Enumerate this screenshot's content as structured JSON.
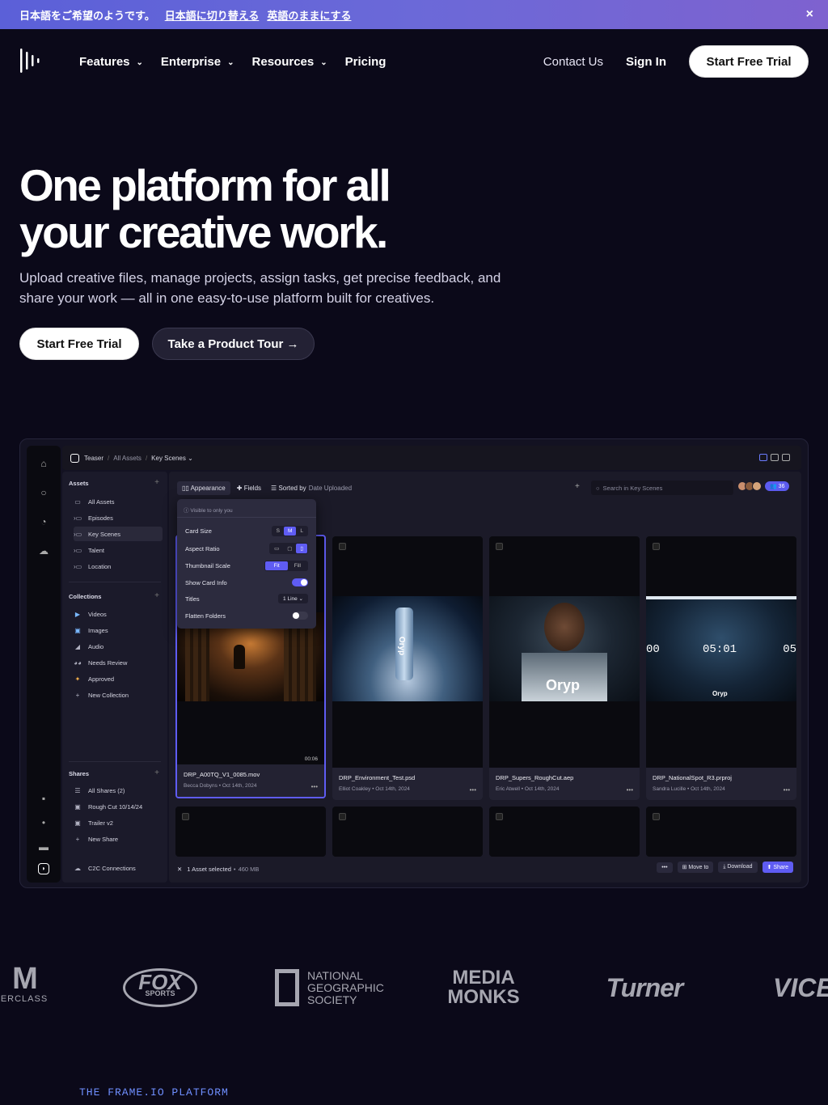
{
  "banner": {
    "text": "日本語をご希望のようです。",
    "switch_link": "日本語に切り替える",
    "keep_link": "英語のままにする",
    "close_icon": "×"
  },
  "nav": {
    "items": [
      {
        "label": "Features"
      },
      {
        "label": "Enterprise"
      },
      {
        "label": "Resources"
      },
      {
        "label": "Pricing"
      }
    ],
    "contact": "Contact Us",
    "signin": "Sign In",
    "trial": "Start Free Trial"
  },
  "hero": {
    "title_line1": "One platform for all",
    "title_line2": "your creative work.",
    "subtitle": "Upload creative files, manage projects, assign tasks, get precise feedback, and share your work — all in one easy-to-use platform built for creatives.",
    "cta_primary": "Start Free Trial",
    "cta_secondary": "Take a Product Tour →"
  },
  "app": {
    "breadcrumb": {
      "project": "Teaser",
      "root": "All Assets",
      "current": "Key Scenes ⌄"
    },
    "sidebar": {
      "assets_header": "Assets",
      "assets": [
        "All Assets",
        "Episodes",
        "Key Scenes",
        "Talent",
        "Location"
      ],
      "collections_header": "Collections",
      "collections": [
        "Videos",
        "Images",
        "Audio",
        "Needs Review",
        "Approved",
        "New Collection"
      ],
      "shares_header": "Shares",
      "shares": [
        "All Shares (2)",
        "Rough Cut 10/14/24",
        "Trailer v2",
        "New Share"
      ],
      "c2c": "C2C Connections"
    },
    "toolbar": {
      "appearance": "Appearance",
      "fields": "Fields",
      "sorted_by": "Sorted by",
      "sort_field": "Date Uploaded",
      "search_placeholder": "Search in Key Scenes",
      "count": "36"
    },
    "popover": {
      "note": "Visible to only you",
      "card_size": "Card Size",
      "card_size_options": [
        "S",
        "M",
        "L"
      ],
      "aspect_ratio": "Aspect Ratio",
      "thumbnail_scale": "Thumbnail Scale",
      "thumbnail_options": [
        "Fit",
        "Fill"
      ],
      "show_card_info": "Show Card Info",
      "titles": "Titles",
      "titles_value": "1 Line ⌄",
      "flatten_folders": "Flatten Folders"
    },
    "cards": [
      {
        "name": "DRP_A00TQ_V1_0085.mov",
        "author": "Becca Dobyns",
        "date": "Oct 14th, 2024",
        "duration": "00:06"
      },
      {
        "name": "DRP_Environment_Test.psd",
        "author": "Elliot Coakley",
        "date": "Oct 14th, 2024"
      },
      {
        "name": "DRP_Supers_RoughCut.aep",
        "author": "Eric Atwell",
        "date": "Oct 14th, 2024"
      },
      {
        "name": "DRP_NationalSpot_R3.prproj",
        "author": "Sandra Lucille",
        "date": "Oct 14th, 2024"
      }
    ],
    "thumb_text": {
      "oryp": "Oryp",
      "timecode": "05:01",
      "tc_left": "00",
      "tc_right": "05"
    },
    "bottom": {
      "selected": "1 Asset selected",
      "size": "460 MB",
      "move": "Move to",
      "download": "Download",
      "share": "Share"
    },
    "colors": {
      "accent": "#5f5cf3"
    }
  },
  "logos": [
    "MASTERCLASS",
    "FOX SPORTS",
    "NATIONAL GEOGRAPHIC SOCIETY",
    "MEDIA MONKS",
    "turner",
    "VICE"
  ],
  "logo_text": {
    "masterclass": "ERCLASS",
    "fox": "FOX",
    "fox_sub": "SPORTS",
    "natgeo_l1": "NATIONAL",
    "natgeo_l2": "GEOGRAPHIC",
    "natgeo_l3": "SOCIETY",
    "media_l1": "MEDIA",
    "media_l2": "MONKS",
    "turner": "Turner",
    "vice": "VICE"
  },
  "platform_tag": "THE FRAME.IO PLATFORM"
}
